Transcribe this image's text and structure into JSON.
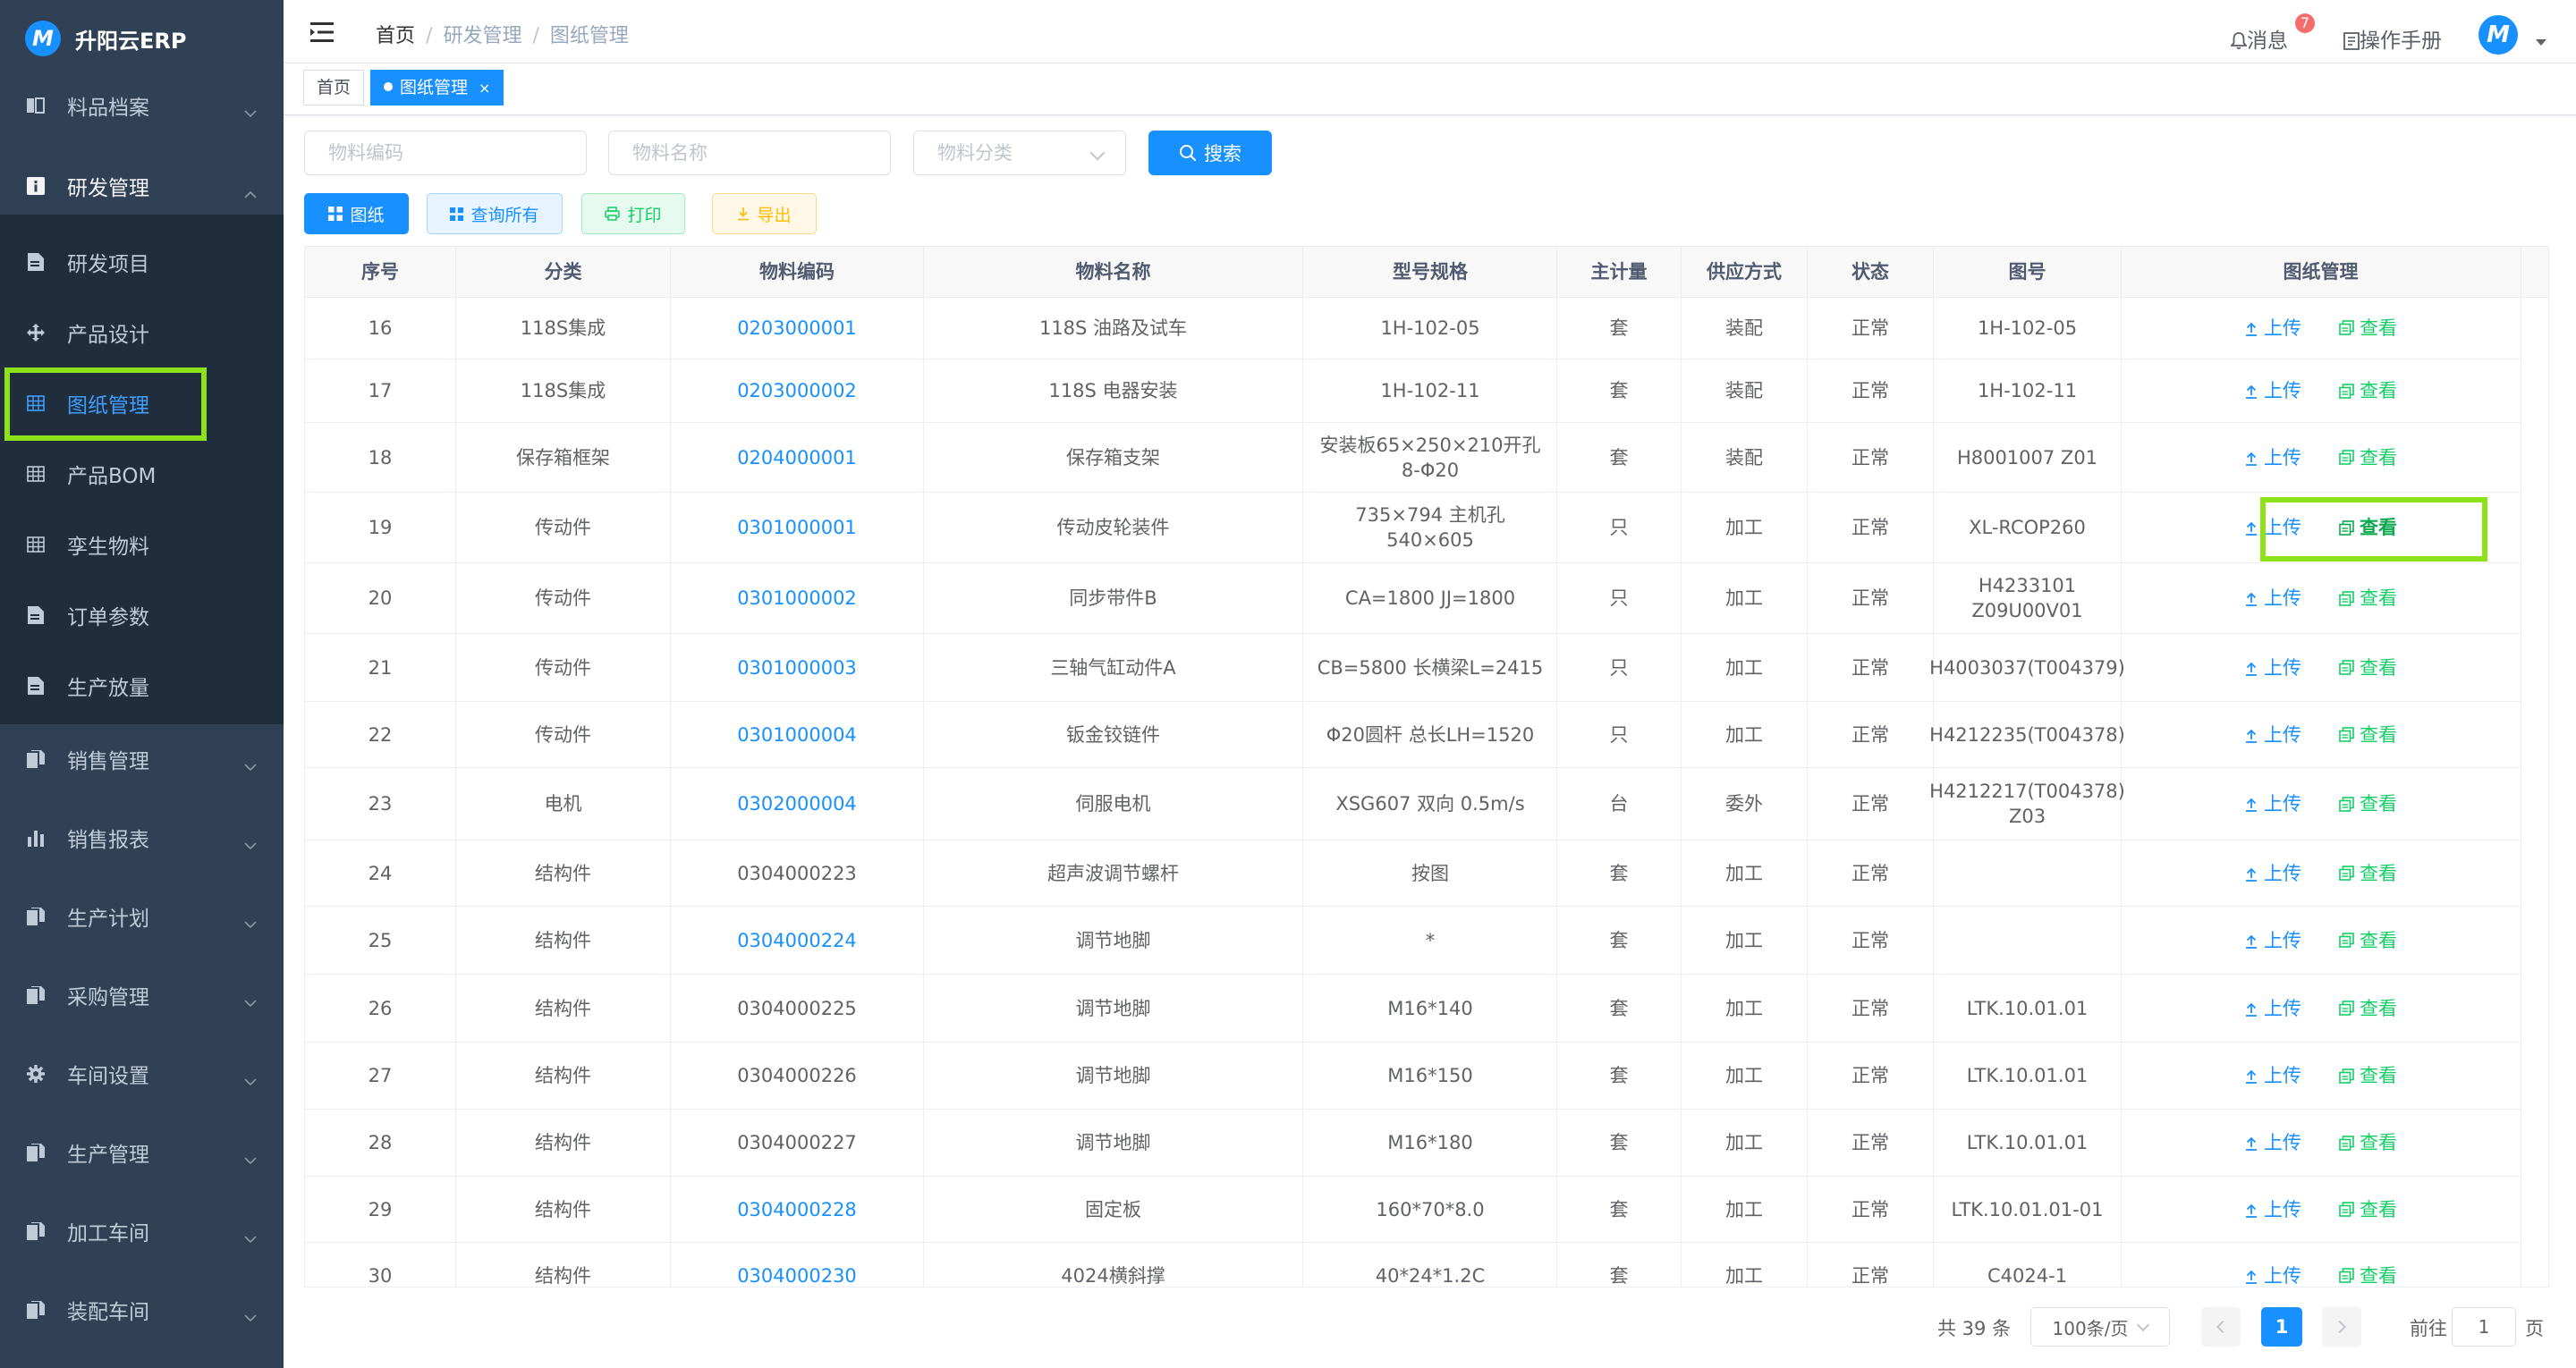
{
  "app": {
    "name": "升阳云ERP",
    "logo_letter": "M"
  },
  "sidebar": {
    "items": [
      {
        "label": "料品档案",
        "icon": "book-icon",
        "has_arrow": true
      },
      {
        "label": "研发管理",
        "icon": "info-box-icon",
        "has_arrow": true,
        "expanded": true
      },
      {
        "label": "研发项目",
        "icon": "document-icon",
        "sub": true
      },
      {
        "label": "产品设计",
        "icon": "move-cross-icon",
        "sub": true
      },
      {
        "label": "图纸管理",
        "icon": "grid-table-icon",
        "sub": true,
        "active": true
      },
      {
        "label": "产品BOM",
        "icon": "grid-table-icon",
        "sub": true
      },
      {
        "label": "孪生物料",
        "icon": "grid-table-icon",
        "sub": true
      },
      {
        "label": "订单参数",
        "icon": "document-icon",
        "sub": true
      },
      {
        "label": "生产放量",
        "icon": "document-icon",
        "sub": true
      },
      {
        "label": "销售管理",
        "icon": "copy-icon",
        "has_arrow": true
      },
      {
        "label": "销售报表",
        "icon": "bar-chart-icon",
        "has_arrow": true
      },
      {
        "label": "生产计划",
        "icon": "copy-icon",
        "has_arrow": true
      },
      {
        "label": "采购管理",
        "icon": "copy-icon",
        "has_arrow": true
      },
      {
        "label": "车间设置",
        "icon": "gear-icon",
        "has_arrow": true
      },
      {
        "label": "生产管理",
        "icon": "copy-icon",
        "has_arrow": true
      },
      {
        "label": "加工车间",
        "icon": "copy-icon",
        "has_arrow": true
      },
      {
        "label": "装配车间",
        "icon": "copy-icon",
        "has_arrow": true
      }
    ]
  },
  "header": {
    "breadcrumb": [
      "首页",
      "研发管理",
      "图纸管理"
    ],
    "separator": "/",
    "messages_label": "消息",
    "messages_count": "7",
    "manual_label": "操作手册",
    "avatar_letter": "M"
  },
  "tags": [
    {
      "label": "首页",
      "active": false
    },
    {
      "label": "图纸管理",
      "active": true,
      "close": "×"
    }
  ],
  "filters": {
    "code_placeholder": "物料编码",
    "name_placeholder": "物料名称",
    "category_placeholder": "物料分类",
    "search_label": "搜索"
  },
  "toolbar": {
    "drawing_label": "图纸",
    "query_all_label": "查询所有",
    "print_label": "打印",
    "export_label": "导出"
  },
  "table": {
    "columns": [
      "序号",
      "分类",
      "物料编码",
      "物料名称",
      "型号规格",
      "主计量",
      "供应方式",
      "状态",
      "图号",
      "图纸管理"
    ],
    "upload_label": "上传",
    "view_label": "查看",
    "rows": [
      {
        "no": "16",
        "category": "118S集成",
        "code": "0203000001",
        "link": true,
        "name": "118S 油路及试车",
        "spec": "1H-102-05",
        "unit": "套",
        "supply": "装配",
        "status": "正常",
        "drawing_no": "1H-102-05"
      },
      {
        "no": "17",
        "category": "118S集成",
        "code": "0203000002",
        "link": true,
        "name": "118S 电器安装",
        "spec": "1H-102-11",
        "unit": "套",
        "supply": "装配",
        "status": "正常",
        "drawing_no": "1H-102-11"
      },
      {
        "no": "18",
        "category": "保存箱框架",
        "code": "0204000001",
        "link": true,
        "name": "保存箱支架",
        "spec": "安装板65×250×210开孔8-Φ20",
        "unit": "套",
        "supply": "装配",
        "status": "正常",
        "drawing_no": "H8001007 Z01"
      },
      {
        "no": "19",
        "category": "传动件",
        "code": "0301000001",
        "link": true,
        "name": "传动皮轮装件",
        "spec": "735×794 主机孔540×605",
        "unit": "只",
        "supply": "加工",
        "status": "正常",
        "drawing_no": "XL-RCOP260"
      },
      {
        "no": "20",
        "category": "传动件",
        "code": "0301000002",
        "link": true,
        "name": "同步带件B",
        "spec": "CA=1800 JJ=1800",
        "unit": "只",
        "supply": "加工",
        "status": "正常",
        "drawing_no": "H4233101 Z09U00V01"
      },
      {
        "no": "21",
        "category": "传动件",
        "code": "0301000003",
        "link": true,
        "name": "三轴气缸动件A",
        "spec": "CB=5800 长横梁L=2415",
        "unit": "只",
        "supply": "加工",
        "status": "正常",
        "drawing_no": "H4003037(T004379)"
      },
      {
        "no": "22",
        "category": "传动件",
        "code": "0301000004",
        "link": true,
        "name": "钣金铰链件",
        "spec": "Φ20圆杆 总长LH=1520",
        "unit": "只",
        "supply": "加工",
        "status": "正常",
        "drawing_no": "H4212235(T004378)"
      },
      {
        "no": "23",
        "category": "电机",
        "code": "0302000004",
        "link": true,
        "name": "伺服电机",
        "spec": "XSG607 双向 0.5m/s",
        "unit": "台",
        "supply": "委外",
        "status": "正常",
        "drawing_no": "H4212217(T004378) Z03"
      },
      {
        "no": "24",
        "category": "结构件",
        "code": "0304000223",
        "link": false,
        "name": "超声波调节螺杆",
        "spec": "按图",
        "unit": "套",
        "supply": "加工",
        "status": "正常",
        "drawing_no": ""
      },
      {
        "no": "25",
        "category": "结构件",
        "code": "0304000224",
        "link": true,
        "name": "调节地脚",
        "spec": "*",
        "unit": "套",
        "supply": "加工",
        "status": "正常",
        "drawing_no": ""
      },
      {
        "no": "26",
        "category": "结构件",
        "code": "0304000225",
        "link": false,
        "name": "调节地脚",
        "spec": "M16*140",
        "unit": "套",
        "supply": "加工",
        "status": "正常",
        "drawing_no": "LTK.10.01.01"
      },
      {
        "no": "27",
        "category": "结构件",
        "code": "0304000226",
        "link": false,
        "name": "调节地脚",
        "spec": "M16*150",
        "unit": "套",
        "supply": "加工",
        "status": "正常",
        "drawing_no": "LTK.10.01.01"
      },
      {
        "no": "28",
        "category": "结构件",
        "code": "0304000227",
        "link": false,
        "name": "调节地脚",
        "spec": "M16*180",
        "unit": "套",
        "supply": "加工",
        "status": "正常",
        "drawing_no": "LTK.10.01.01"
      },
      {
        "no": "29",
        "category": "结构件",
        "code": "0304000228",
        "link": true,
        "name": "固定板",
        "spec": "160*70*8.0",
        "unit": "套",
        "supply": "加工",
        "status": "正常",
        "drawing_no": "LTK.10.01.01-01"
      },
      {
        "no": "30",
        "category": "结构件",
        "code": "0304000230",
        "link": true,
        "name": "4024横斜撑",
        "spec": "40*24*1.2C",
        "unit": "套",
        "supply": "加工",
        "status": "正常",
        "drawing_no": "C4024-1"
      }
    ]
  },
  "pagination": {
    "total_label": "共 39 条",
    "page_size": "100条/页",
    "current_page": "1",
    "goto_label": "前往",
    "goto_value": "1",
    "page_suffix": "页"
  },
  "colors": {
    "sidebar_bg": "#304156",
    "primary": "#1890ff",
    "highlight": "#8ee21a",
    "view_green": "#13ce66"
  }
}
